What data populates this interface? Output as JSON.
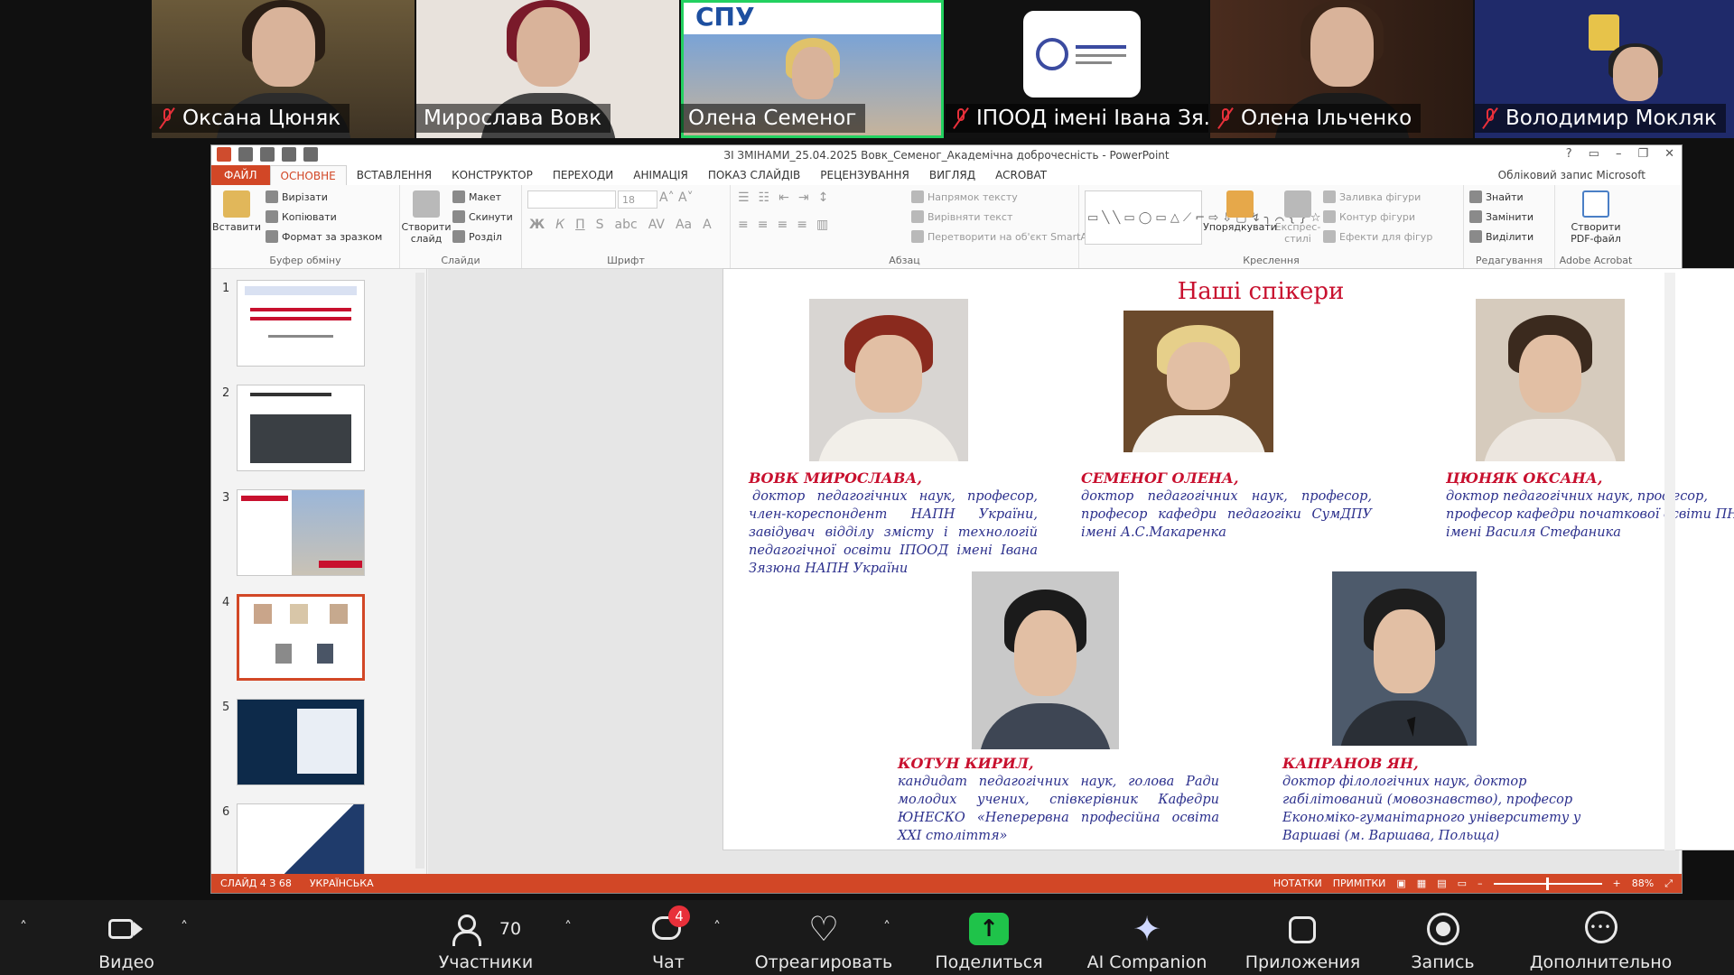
{
  "participants": [
    {
      "name": "Оксана Цюняк",
      "muted": true
    },
    {
      "name": "Мирослава Вовк",
      "muted": false
    },
    {
      "name": "Олена Семеног",
      "muted": false,
      "active": true,
      "banner": "СПУ"
    },
    {
      "name": "ІПООД імені Івана Зя...",
      "muted": true
    },
    {
      "name": "Олена Ільченко",
      "muted": true
    },
    {
      "name": "Володимир Мокляк",
      "muted": true
    }
  ],
  "ppt": {
    "title": "ЗІ ЗМІНАМИ_25.04.2025 Вовк_Семеног_Академічна доброчесність - PowerPoint",
    "tabs": [
      "ФАЙЛ",
      "ОСНОВНЕ",
      "ВСТАВЛЕННЯ",
      "КОНСТРУКТОР",
      "ПЕРЕХОДИ",
      "АНІМАЦІЯ",
      "ПОКАЗ СЛАЙДІВ",
      "РЕЦЕНЗУВАННЯ",
      "ВИГЛЯД",
      "ACROBAT"
    ],
    "account": "Обліковий запис Microsoft",
    "ribbon": {
      "clipboard": {
        "paste": "Вставити",
        "cut": "Вирізати",
        "copy": "Копіювати",
        "format": "Формат за зразком",
        "group": "Буфер обміну"
      },
      "slides": {
        "new": "Створити слайд",
        "layout": "Макет",
        "reset": "Скинути",
        "section": "Розділ",
        "group": "Слайди"
      },
      "font": {
        "size": "18",
        "group": "Шрифт"
      },
      "paragraph": {
        "dir": "Напрямок тексту",
        "align": "Вирівняти текст",
        "smartart": "Перетворити на об'єкт SmartArt",
        "group": "Абзац"
      },
      "drawing": {
        "arrange": "Упорядкувати",
        "styles": "Експрес-стилі",
        "fill": "Заливка фігури",
        "outline": "Контур фігури",
        "effects": "Ефекти для фігур",
        "group": "Креслення"
      },
      "editing": {
        "find": "Знайти",
        "replace": "Замінити",
        "select": "Виділити",
        "group": "Редагування"
      },
      "acrobat": {
        "create": "Створити PDF-файл",
        "group": "Adobe Acrobat"
      }
    },
    "thumb_numbers": [
      "1",
      "2",
      "3",
      "4",
      "5",
      "6"
    ],
    "status": {
      "slide": "СЛАЙД 4 З 68",
      "lang": "УКРАЇНСЬКА",
      "notes": "НОТАТКИ",
      "comments": "ПРИМІТКИ",
      "zoom": "88%"
    }
  },
  "slide": {
    "title": "Наші спікери",
    "speakers": [
      {
        "name": "ВОВК МИРОСЛАВА,",
        "desc": "доктор педагогічних наук, професор, член-кореспондент НАПН України, завідувач відділу змісту і технологій педагогічної освіти ІПООД імені Івана Зязюна НАПН України"
      },
      {
        "name": "СЕМЕНОГ ОЛЕНА,",
        "desc": "доктор педагогічних наук, професор, професор кафедри педагогіки СумДПУ імені А.С.Макаренка"
      },
      {
        "name": "ЦЮНЯК ОКСАНА,",
        "desc": "доктор педагогічних наук, професор, професор кафедри початкової освіти ПНУ імені Василя Стефаника"
      },
      {
        "name": "КОТУН КИРИЛ,",
        "desc": "кандидат педагогічних наук, голова Ради молодих учених, співкерівник Кафедри ЮНЕСКО «Неперервна професійна освіта XXI століття»"
      },
      {
        "name": "КАПРАНОВ ЯН,",
        "desc": "доктор філологічних наук, доктор габілітований (мовознавство), професор Економіко-гуманітарного університету у Варшаві (м. Варшава, Польща)"
      }
    ]
  },
  "toolbar": {
    "video": "Видео",
    "participants": "Участники",
    "participants_count": "70",
    "chat": "Чат",
    "chat_badge": "4",
    "react": "Отреагировать",
    "share": "Поделиться",
    "ai": "AI Companion",
    "apps": "Приложения",
    "record": "Запись",
    "more": "Дополнительно"
  }
}
